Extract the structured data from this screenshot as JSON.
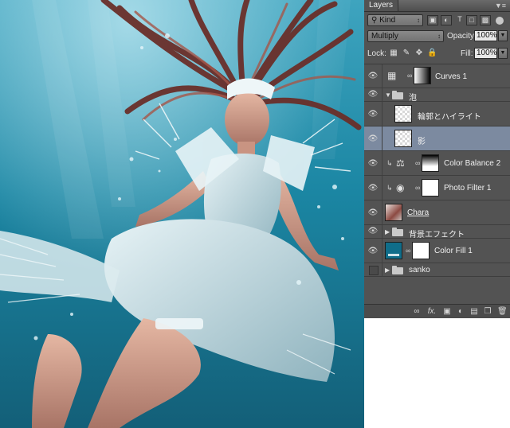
{
  "panel": {
    "title": "Layers",
    "menu_icon": "panel-menu-icon",
    "filter": {
      "value": "Kind",
      "icons": [
        "image-filter-icon",
        "adjustment-filter-icon",
        "type-filter-icon",
        "shape-filter-icon",
        "smart-object-filter-icon"
      ]
    },
    "blend_mode": "Multiply",
    "opacity_label": "Opacity:",
    "opacity_value": "100%",
    "lock_label": "Lock:",
    "fill_label": "Fill:",
    "fill_value": "100%"
  },
  "layers": [
    {
      "name": "Curves 1",
      "kind": "adjustment",
      "icon": "curves-icon",
      "visible": true
    },
    {
      "name": "泡",
      "kind": "group-open",
      "visible": true
    },
    {
      "name": "輪郭とハイライト",
      "kind": "pixel",
      "visible": true
    },
    {
      "name": "影",
      "kind": "pixel",
      "visible": true,
      "selected": true
    },
    {
      "name": "Color Balance 2",
      "kind": "adjustment",
      "icon": "color-balance-icon",
      "visible": true,
      "clipped": true
    },
    {
      "name": "Photo Filter 1",
      "kind": "adjustment",
      "icon": "photo-filter-icon",
      "visible": true,
      "clipped": true
    },
    {
      "name": "Chara",
      "kind": "pixel",
      "visible": true
    },
    {
      "name": "背景エフェクト",
      "kind": "group-closed",
      "visible": true
    },
    {
      "name": "Color Fill 1",
      "kind": "fill",
      "visible": true
    },
    {
      "name": "sanko",
      "kind": "group-closed",
      "visible": false
    }
  ],
  "footer_icons": [
    "link-layers-icon",
    "fx-icon",
    "add-mask-icon",
    "new-adjustment-icon",
    "new-group-icon",
    "new-layer-icon",
    "trash-icon"
  ],
  "footer_labels": {
    "fx": "fx."
  },
  "colors": {
    "panel_bg": "#535353",
    "selected_row": "#7c8aa0",
    "water": "#1d7f9c",
    "fill_swatch": "#0f6d8a"
  }
}
